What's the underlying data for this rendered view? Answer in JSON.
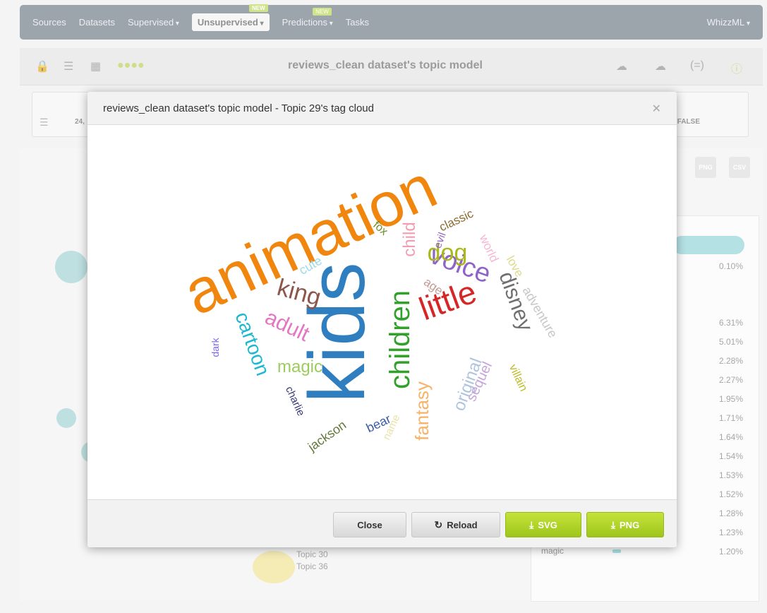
{
  "app": {
    "nav": {
      "items": [
        {
          "label": "Sources",
          "caret": false,
          "active": false,
          "badge": ""
        },
        {
          "label": "Datasets",
          "caret": false,
          "active": false,
          "badge": ""
        },
        {
          "label": "Supervised",
          "caret": true,
          "active": false,
          "badge": ""
        },
        {
          "label": "Unsupervised",
          "caret": true,
          "active": true,
          "badge": "NEW"
        },
        {
          "label": "Predictions",
          "caret": true,
          "active": false,
          "badge": "NEW"
        },
        {
          "label": "Tasks",
          "caret": false,
          "active": false,
          "badge": ""
        }
      ],
      "user_menu": "WhizzML"
    },
    "toolbar": {
      "title": "reviews_clean dataset's topic model"
    },
    "panel": {
      "value": "FALSE",
      "prefix": "24,"
    },
    "right_panel": {
      "percentages": [
        "0.10%",
        "6.31%",
        "5.01%",
        "2.28%",
        "2.27%",
        "1.95%",
        "1.71%",
        "1.64%",
        "1.54%",
        "1.53%",
        "1.52%",
        "1.28%",
        "1.23%",
        "1.20%"
      ],
      "last_word": "magic"
    },
    "bg_topics": [
      "Topic 30",
      "Topic 36"
    ],
    "download_buttons": [
      "PNG",
      "CSV"
    ]
  },
  "modal": {
    "title": "reviews_clean dataset's topic model - Topic 29's tag cloud",
    "close_icon": "close-icon",
    "buttons": {
      "close": "Close",
      "reload": "Reload",
      "svg": "SVG",
      "png": "PNG"
    }
  },
  "tag_cloud": [
    {
      "text": "animation",
      "color": "#f0860e"
    },
    {
      "text": "kids",
      "color": "#2f7fc0"
    },
    {
      "text": "children",
      "color": "#33a02c"
    },
    {
      "text": "little",
      "color": "#d62728"
    },
    {
      "text": "voice",
      "color": "#9063c9"
    },
    {
      "text": "disney",
      "color": "#6f6f6f"
    },
    {
      "text": "dog",
      "color": "#aab81e"
    },
    {
      "text": "king",
      "color": "#8c564b"
    },
    {
      "text": "adult",
      "color": "#e377c2"
    },
    {
      "text": "cartoon",
      "color": "#1bb8cf"
    },
    {
      "text": "magic",
      "color": "#9ccc5e"
    },
    {
      "text": "child",
      "color": "#f39db2"
    },
    {
      "text": "fantasy",
      "color": "#f7b267"
    },
    {
      "text": "original",
      "color": "#b0c4de"
    },
    {
      "text": "sequel",
      "color": "#c5a5d9"
    },
    {
      "text": "adventure",
      "color": "#c7c7c7"
    },
    {
      "text": "classic",
      "color": "#8c6d31"
    },
    {
      "text": "world",
      "color": "#f7b6d2"
    },
    {
      "text": "love",
      "color": "#dbdb8d"
    },
    {
      "text": "evil",
      "color": "#9467bd"
    },
    {
      "text": "age",
      "color": "#c49c94"
    },
    {
      "text": "fox",
      "color": "#6b8e23"
    },
    {
      "text": "cute",
      "color": "#9edae5"
    },
    {
      "text": "dark",
      "color": "#7b68ee"
    },
    {
      "text": "charlie",
      "color": "#393b79"
    },
    {
      "text": "jackson",
      "color": "#637939"
    },
    {
      "text": "bear",
      "color": "#3b5ca8"
    },
    {
      "text": "name",
      "color": "#e7e3a8"
    },
    {
      "text": "villain",
      "color": "#bcbd22"
    }
  ]
}
